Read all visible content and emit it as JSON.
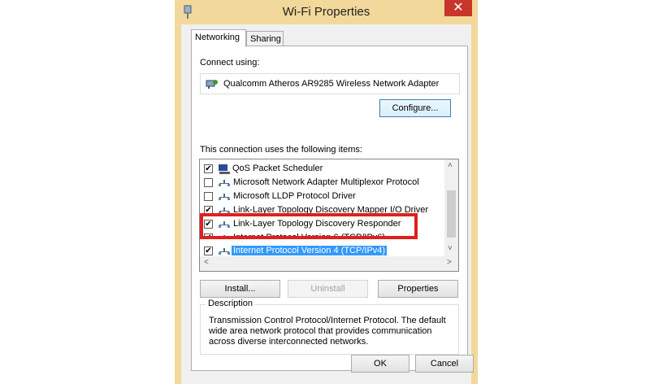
{
  "window": {
    "title": "Wi-Fi Properties",
    "close_glyph": "✕",
    "frame_color": "#f2d89a",
    "close_color": "#c7352b"
  },
  "tabs": [
    {
      "label": "Networking",
      "active": true
    },
    {
      "label": "Sharing",
      "active": false
    }
  ],
  "connect": {
    "label": "Connect using:",
    "adapter": "Qualcomm Atheros AR9285 Wireless Network Adapter",
    "configure_label": "Configure..."
  },
  "items_label": "This connection uses the following items:",
  "items": [
    {
      "label": "QoS Packet Scheduler",
      "checked": true,
      "icon": "scheduler-icon"
    },
    {
      "label": "Microsoft Network Adapter Multiplexor Protocol",
      "checked": false,
      "icon": "protocol-icon"
    },
    {
      "label": "Microsoft LLDP Protocol Driver",
      "checked": false,
      "icon": "protocol-icon"
    },
    {
      "label": "Link-Layer Topology Discovery Mapper I/O Driver",
      "checked": true,
      "icon": "protocol-icon"
    },
    {
      "label": "Link-Layer Topology Discovery Responder",
      "checked": true,
      "icon": "protocol-icon"
    },
    {
      "label": "Internet Protocol Version 6 (TCP/IPv6)",
      "checked": true,
      "icon": "protocol-icon"
    },
    {
      "label": "Internet Protocol Version 4 (TCP/IPv4)",
      "checked": true,
      "icon": "protocol-icon",
      "selected": true
    }
  ],
  "scroll": {
    "up": "˄",
    "down": "˅",
    "left": "˂",
    "right": "˃"
  },
  "buttons": {
    "install": "Install...",
    "uninstall": "Uninstall",
    "properties": "Properties",
    "ok": "OK",
    "cancel": "Cancel"
  },
  "description": {
    "title": "Description",
    "text": "Transmission Control Protocol/Internet Protocol. The default wide area network protocol that provides communication across diverse interconnected networks."
  },
  "check_glyph": "✔",
  "highlight_color": "#e0201c",
  "selection_color": "#3399ff"
}
